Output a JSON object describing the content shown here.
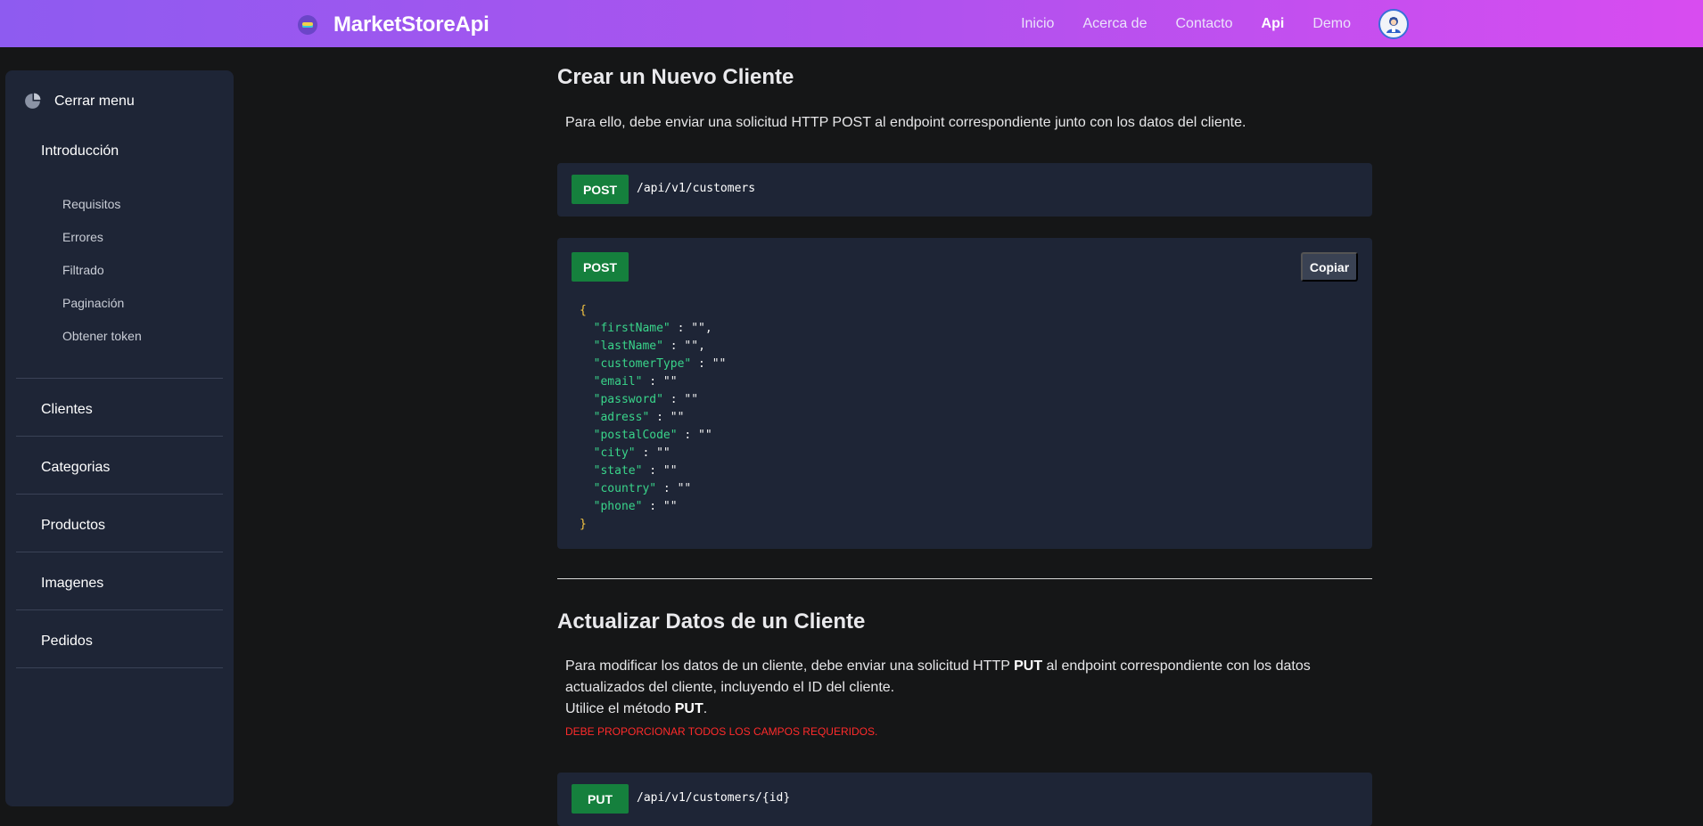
{
  "brand": {
    "name": "MarketStoreApi"
  },
  "nav": {
    "links": [
      {
        "label": "Inicio"
      },
      {
        "label": "Acerca de"
      },
      {
        "label": "Contacto"
      },
      {
        "label": "Api"
      },
      {
        "label": "Demo"
      }
    ],
    "active": "Api"
  },
  "sidebar": {
    "close_label": "Cerrar menu",
    "intro_title": "Introducción",
    "intro_items": [
      "Requisitos",
      "Errores",
      "Filtrado",
      "Paginación",
      "Obtener token"
    ],
    "sections": [
      "Clientes",
      "Categorias",
      "Productos",
      "Imagenes",
      "Pedidos"
    ]
  },
  "create": {
    "title": "Crear un Nuevo Cliente",
    "description": "Para ello, debe enviar una solicitud HTTP POST al endpoint correspondiente junto con los datos del cliente.",
    "endpoint_method": "POST",
    "endpoint_path": "/api/v1/customers",
    "code_method": "POST",
    "copy_label": "Copiar",
    "code_open": "{",
    "code_close": "}",
    "fields": [
      {
        "key": "\"firstName\"",
        "rest": " : \"\","
      },
      {
        "key": "\"lastName\"",
        "rest": " : \"\","
      },
      {
        "key": "\"customerType\"",
        "rest": " : \"\""
      },
      {
        "key": "\"email\"",
        "rest": " : \"\""
      },
      {
        "key": "\"password\"",
        "rest": " : \"\""
      },
      {
        "key": "\"adress\"",
        "rest": " : \"\""
      },
      {
        "key": "\"postalCode\"",
        "rest": " : \"\""
      },
      {
        "key": "\"city\"",
        "rest": " : \"\""
      },
      {
        "key": "\"state\"",
        "rest": " : \"\""
      },
      {
        "key": "\"country\"",
        "rest": " : \"\""
      },
      {
        "key": "\"phone\"",
        "rest": " : \"\""
      }
    ]
  },
  "update": {
    "title": "Actualizar Datos de un Cliente",
    "desc_part1": "Para modificar los datos de un cliente, debe enviar una solicitud HTTP ",
    "desc_bold": "PUT",
    "desc_part2": " al endpoint correspondiente con los datos actualizados del cliente, incluyendo el ID del cliente.",
    "method_line_part1": "Utilice el método ",
    "method_line_bold": "PUT",
    "method_line_part2": ".",
    "warning": "DEBE PROPORCIONAR TODOS LOS CAMPOS REQUERIDOS.",
    "endpoint_method": "PUT",
    "endpoint_path": "/api/v1/customers/{id}"
  },
  "colors": {
    "nav_gradient_start": "#8e5bf0",
    "nav_gradient_end": "#d84cf0",
    "method_green": "#15803d",
    "warning_red": "#ff2b2b",
    "json_key_green": "#39d48a",
    "json_brace_yellow": "#f5c542"
  },
  "icons": {
    "brand": "brand-logo-icon",
    "avatar": "user-avatar-icon",
    "close_menu": "pie-chart-icon"
  }
}
